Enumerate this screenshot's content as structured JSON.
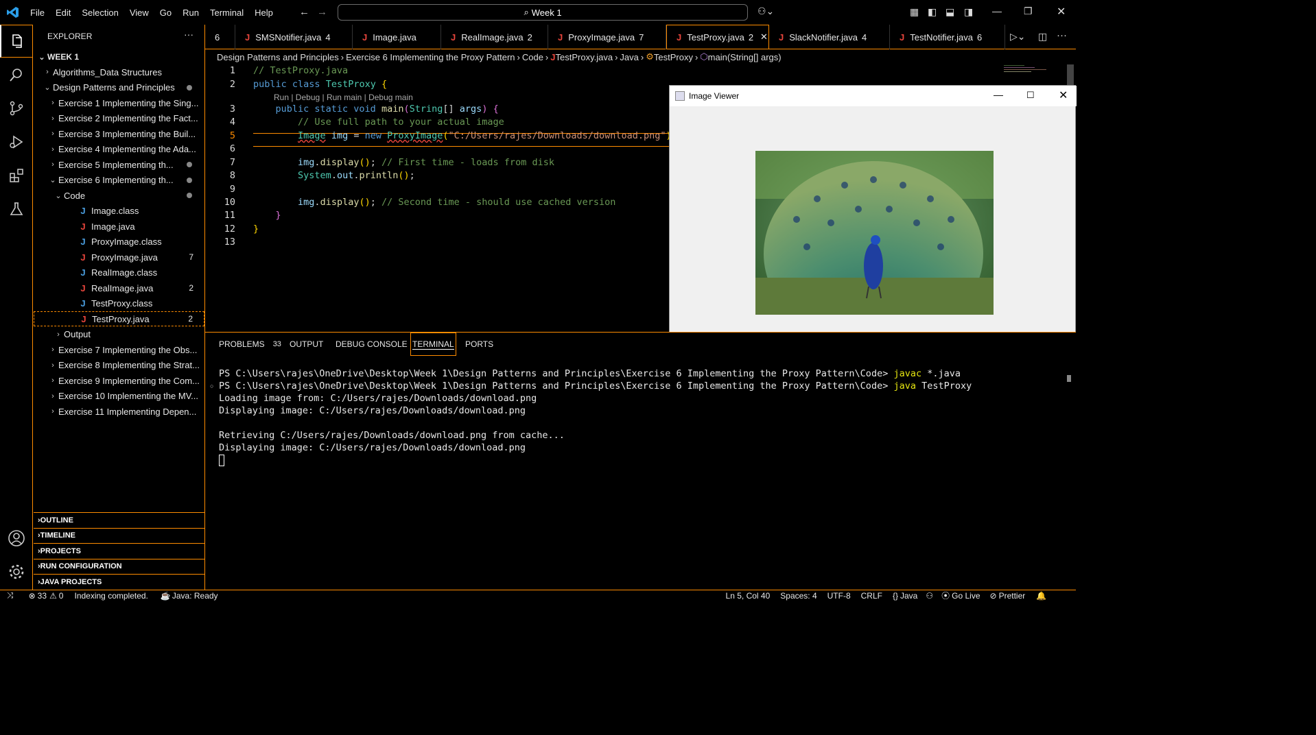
{
  "titlebar": {
    "menu": [
      "File",
      "Edit",
      "Selection",
      "View",
      "Go",
      "Run",
      "Terminal",
      "Help"
    ],
    "search": "Week 1"
  },
  "sidebar": {
    "title": "EXPLORER",
    "more": "···",
    "root": "WEEK 1",
    "tree": [
      {
        "label": "Algorithms_Data Structures",
        "indent": 1,
        "chev": "›"
      },
      {
        "label": "Design Patterns and Principles",
        "indent": 1,
        "chev": "⌄",
        "dot": true
      },
      {
        "label": "Exercise 1 Implementing the Sing...",
        "indent": 2,
        "chev": "›"
      },
      {
        "label": "Exercise 2 Implementing the Fact...",
        "indent": 2,
        "chev": "›"
      },
      {
        "label": "Exercise 3 Implementing the Buil...",
        "indent": 2,
        "chev": "›"
      },
      {
        "label": "Exercise 4 Implementing the Ada...",
        "indent": 2,
        "chev": "›"
      },
      {
        "label": "Exercise 5 Implementing th...",
        "indent": 2,
        "chev": "›",
        "dot": true
      },
      {
        "label": "Exercise 6 Implementing th...",
        "indent": 2,
        "chev": "⌄",
        "dot": true
      },
      {
        "label": "Code",
        "indent": 3,
        "chev": "⌄",
        "dot": true
      },
      {
        "label": "Image.class",
        "indent": 4,
        "file": "class"
      },
      {
        "label": "Image.java",
        "indent": 4,
        "file": "java"
      },
      {
        "label": "ProxyImage.class",
        "indent": 4,
        "file": "class"
      },
      {
        "label": "ProxyImage.java",
        "indent": 4,
        "file": "java",
        "badge": "7"
      },
      {
        "label": "RealImage.class",
        "indent": 4,
        "file": "class"
      },
      {
        "label": "RealImage.java",
        "indent": 4,
        "file": "java",
        "badge": "2"
      },
      {
        "label": "TestProxy.class",
        "indent": 4,
        "file": "class"
      },
      {
        "label": "TestProxy.java",
        "indent": 4,
        "file": "java",
        "badge": "2",
        "selected": true
      },
      {
        "label": "Output",
        "indent": 3,
        "chev": "›"
      },
      {
        "label": "Exercise 7 Implementing the Obs...",
        "indent": 2,
        "chev": "›"
      },
      {
        "label": "Exercise 8 Implementing the Strat...",
        "indent": 2,
        "chev": "›"
      },
      {
        "label": "Exercise 9 Implementing the Com...",
        "indent": 2,
        "chev": "›"
      },
      {
        "label": "Exercise 10 Implementing the MV...",
        "indent": 2,
        "chev": "›"
      },
      {
        "label": "Exercise 11 Implementing Depen...",
        "indent": 2,
        "chev": "›"
      }
    ],
    "sections": [
      "OUTLINE",
      "TIMELINE",
      "PROJECTS",
      "RUN CONFIGURATION",
      "JAVA PROJECTS"
    ]
  },
  "tabs": [
    {
      "label": "6",
      "partial": true
    },
    {
      "label": "SMSNotifier.java",
      "badge": "4"
    },
    {
      "label": "Image.java",
      "badge": ""
    },
    {
      "label": "RealImage.java",
      "badge": "2"
    },
    {
      "label": "ProxyImage.java",
      "badge": "7"
    },
    {
      "label": "TestProxy.java",
      "badge": "2",
      "active": true
    },
    {
      "label": "SlackNotifier.java",
      "badge": "4"
    },
    {
      "label": "TestNotifier.java",
      "badge": "6"
    }
  ],
  "breadcrumb": [
    "Design Patterns and Principles",
    "Exercise 6 Implementing the Proxy Pattern",
    "Code",
    "TestProxy.java",
    "Java",
    "TestProxy",
    "main(String[] args)"
  ],
  "editor": {
    "codelens": "Run | Debug | Run main | Debug main",
    "lines": [
      "1",
      "2",
      "3",
      "4",
      "5",
      "6",
      "7",
      "8",
      "9",
      "10",
      "11",
      "12",
      "13"
    ]
  },
  "panel": {
    "tabs": [
      "PROBLEMS",
      "OUTPUT",
      "DEBUG CONSOLE",
      "TERMINAL",
      "PORTS"
    ],
    "problems_count": "33",
    "terminal": [
      "PS C:\\Users\\rajes\\OneDrive\\Desktop\\Week 1\\Design Patterns and Principles\\Exercise 6 Implementing the Proxy Pattern\\Code> ",
      "javac",
      " *.java",
      "PS C:\\Users\\rajes\\OneDrive\\Desktop\\Week 1\\Design Patterns and Principles\\Exercise 6 Implementing the Proxy Pattern\\Code> ",
      "java",
      " TestProxy",
      "Loading image from: C:/Users/rajes/Downloads/download.png",
      "Displaying image: C:/Users/rajes/Downloads/download.png",
      "Retrieving C:/Users/rajes/Downloads/download.png from cache...",
      "Displaying image: C:/Users/rajes/Downloads/download.png"
    ]
  },
  "viewer": {
    "title": "Image Viewer"
  },
  "status": {
    "errors": "33",
    "warnings": "0",
    "indexing": "Indexing completed.",
    "java": "Java: Ready",
    "position": "Ln 5, Col 40",
    "spaces": "Spaces: 4",
    "encoding": "UTF-8",
    "eol": "CRLF",
    "language": "Java",
    "golive": "Go Live",
    "prettier": "Prettier"
  },
  "colors": {
    "accent": "#ff8c00",
    "java_icon": "#e8453c",
    "class_icon": "#4a9ee0"
  }
}
